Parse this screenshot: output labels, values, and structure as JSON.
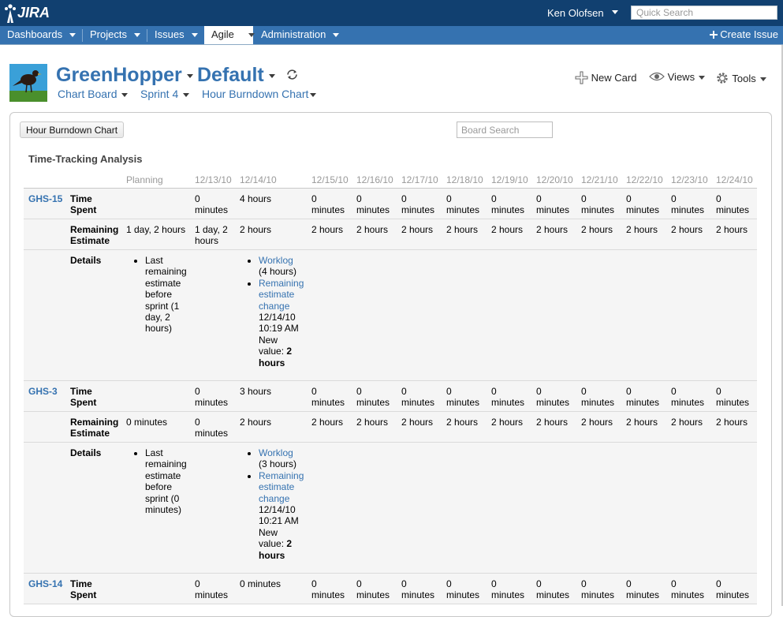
{
  "header": {
    "logo": "JIRA",
    "user": "Ken Olofsen",
    "quick_search_placeholder": "Quick Search"
  },
  "nav": {
    "items": [
      "Dashboards",
      "Projects",
      "Issues",
      "Agile",
      "Administration"
    ],
    "create": "Create Issue"
  },
  "board": {
    "project": "GreenHopper",
    "board": "Default",
    "chart_board": "Chart Board",
    "sprint": "Sprint 4",
    "chart": "Hour Burndown Chart",
    "new_card": "New Card",
    "views": "Views",
    "tools": "Tools"
  },
  "panel": {
    "button": "Hour Burndown Chart",
    "search_placeholder": "Board Search",
    "heading": "Time-Tracking Analysis"
  },
  "columns": [
    "Planning",
    "12/13/10",
    "12/14/10",
    "12/15/10",
    "12/16/10",
    "12/17/10",
    "12/18/10",
    "12/19/10",
    "12/20/10",
    "12/21/10",
    "12/22/10",
    "12/23/10",
    "12/24/10"
  ],
  "labels": {
    "time_spent": [
      "Time",
      "Spent"
    ],
    "remaining": [
      "Remaining",
      "Estimate"
    ],
    "details": "Details",
    "zero_minutes": [
      "0",
      "minutes"
    ],
    "two_hours": "2 hours"
  },
  "issues": [
    {
      "key": "GHS-15",
      "spent_1213": [
        "0",
        "minutes"
      ],
      "spent_1214": "4 hours",
      "remain_planning": "1 day, 2 hours",
      "remain_1213": [
        "1 day, 2",
        "hours"
      ],
      "remain_1214": "2 hours",
      "planning_detail": [
        "Last",
        "remaining",
        "estimate",
        "before",
        "sprint (1",
        "day, 2",
        "hours)"
      ],
      "worklog": "Worklog",
      "worklog_hours": "(4 hours)",
      "remaining_link": [
        "Remaining",
        "estimate",
        "change"
      ],
      "change_date": "12/14/10",
      "change_time": "10:19 AM",
      "new_label": [
        "New",
        "value:"
      ],
      "new_value": "2",
      "new_unit": "hours"
    },
    {
      "key": "GHS-3",
      "spent_1213": [
        "0",
        "minutes"
      ],
      "spent_1214": "3 hours",
      "remain_planning": "0 minutes",
      "remain_1213": [
        "0",
        "minutes"
      ],
      "remain_1214": "2 hours",
      "planning_detail": [
        "Last",
        "remaining",
        "estimate",
        "before",
        "sprint (0",
        "minutes)"
      ],
      "worklog": "Worklog",
      "worklog_hours": "(3 hours)",
      "remaining_link": [
        "Remaining",
        "estimate",
        "change"
      ],
      "change_date": "12/14/10",
      "change_time": "10:21 AM",
      "new_label": [
        "New",
        "value:"
      ],
      "new_value": "2",
      "new_unit": "hours"
    },
    {
      "key": "GHS-14",
      "spent_1213": [
        "0",
        "minutes"
      ],
      "spent_1214": "0 minutes"
    }
  ]
}
